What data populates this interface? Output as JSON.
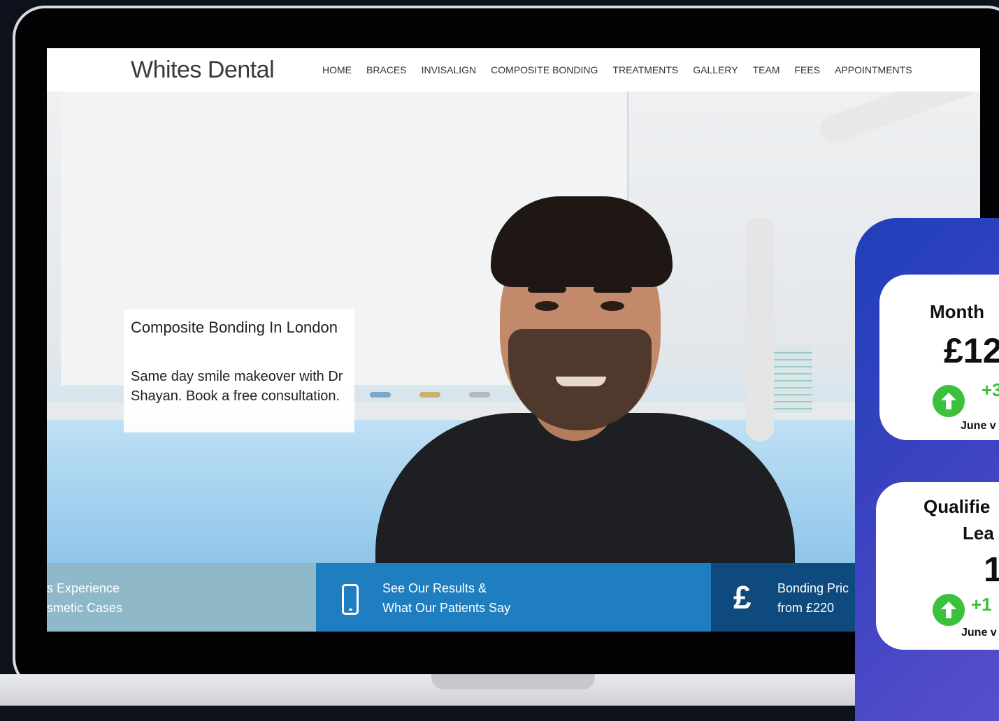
{
  "site": {
    "logo": "Whites Dental",
    "nav": [
      "HOME",
      "BRACES",
      "INVISALIGN",
      "COMPOSITE BONDING",
      "TREATMENTS",
      "GALLERY",
      "TEAM",
      "FEES",
      "APPOINTMENTS"
    ]
  },
  "hero": {
    "title": "Composite Bonding In London",
    "subtitle": "Same day smile makeover with Dr Shayan. Book a free consultation."
  },
  "strips": [
    {
      "line1": "s Experience",
      "line2": "smetic Cases"
    },
    {
      "line1": "See Our Results &",
      "line2": "What Our Patients Say",
      "icon": "phone-icon"
    },
    {
      "line1": "Bonding Pric",
      "line2": "from £220",
      "icon": "pound-icon"
    }
  ],
  "stats": {
    "card1": {
      "label": "Month",
      "value": "£12",
      "change": "+3",
      "note": "June v",
      "icon": "arrow-up-icon"
    },
    "card2": {
      "label1": "Qualifie",
      "label2": "Lea",
      "value": "1",
      "change": "+1",
      "note": "June v",
      "icon": "arrow-up-icon"
    }
  },
  "colors": {
    "accent": "#1e7ec0",
    "positive": "#3cc13c",
    "panel": "#3c43c2"
  }
}
